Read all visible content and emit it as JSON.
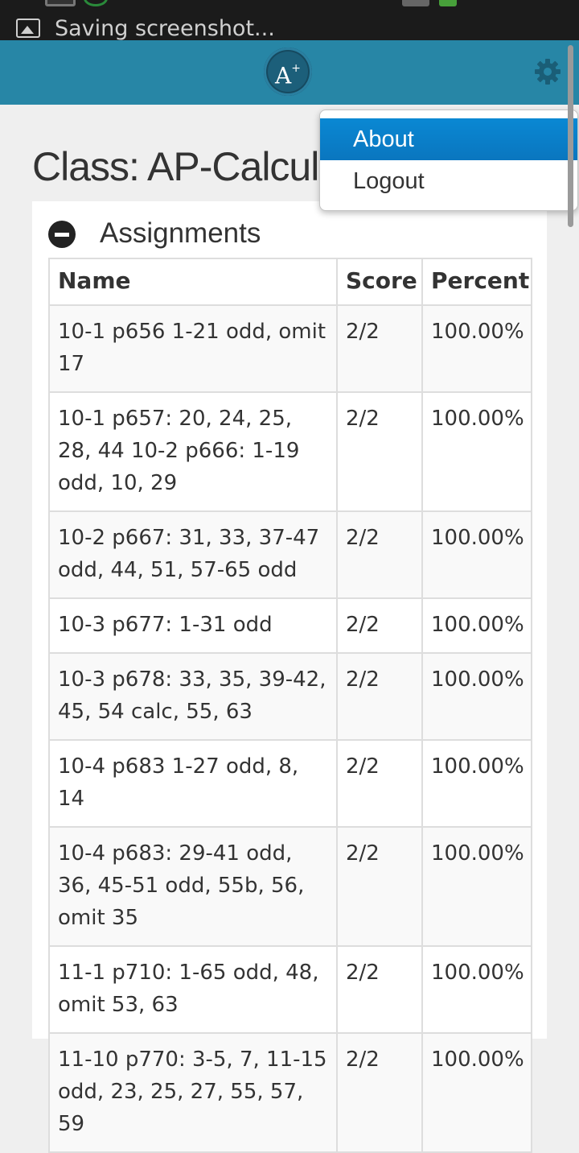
{
  "status_bar": {
    "notification_text": "Saving screenshot..."
  },
  "app_bar": {
    "logo_text": "A",
    "logo_sup": "+"
  },
  "page": {
    "title": "Class: AP-Calculu"
  },
  "menu": {
    "items": [
      {
        "label": "About",
        "active": true
      },
      {
        "label": "Logout",
        "active": false
      }
    ]
  },
  "assignments": {
    "heading": "Assignments",
    "columns": [
      "Name",
      "Score",
      "Percent"
    ],
    "rows": [
      {
        "name": "10-1 p656 1-21 odd, omit 17",
        "score": "2/2",
        "percent": "100.00%"
      },
      {
        "name": "10-1 p657: 20, 24, 25, 28, 44 10-2 p666: 1-19 odd, 10, 29",
        "score": "2/2",
        "percent": "100.00%"
      },
      {
        "name": "10-2 p667: 31, 33, 37-47 odd, 44, 51, 57-65 odd",
        "score": "2/2",
        "percent": "100.00%"
      },
      {
        "name": "10-3 p677: 1-31 odd",
        "score": "2/2",
        "percent": "100.00%"
      },
      {
        "name": "10-3 p678: 33, 35, 39-42, 45, 54 calc, 55, 63",
        "score": "2/2",
        "percent": "100.00%"
      },
      {
        "name": "10-4 p683 1-27 odd, 8, 14",
        "score": "2/2",
        "percent": "100.00%"
      },
      {
        "name": "10-4 p683: 29-41 odd, 36, 45-51 odd, 55b, 56, omit 35",
        "score": "2/2",
        "percent": "100.00%"
      },
      {
        "name": "11-1 p710: 1-65 odd, 48, omit 53, 63",
        "score": "2/2",
        "percent": "100.00%"
      },
      {
        "name": "11-10 p770: 3-5, 7, 11-15 odd, 23, 25, 27, 55, 57, 59",
        "score": "2/2",
        "percent": "100.00%"
      }
    ]
  },
  "colors": {
    "app_bar": "#2786a6",
    "menu_active": "#0a7fc9",
    "status_bar": "#1b1b1b"
  },
  "icons": {
    "notification": "image-icon",
    "logo": "a-plus-logo",
    "settings": "gear-icon",
    "collapse": "minus-circle-icon"
  }
}
